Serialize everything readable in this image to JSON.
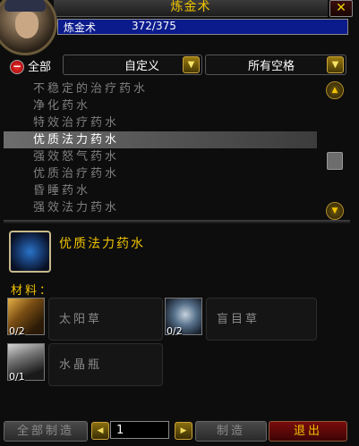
{
  "window": {
    "title": "炼金术",
    "close_icon": "close-icon"
  },
  "skill": {
    "name": "炼金术",
    "value": "372/375"
  },
  "filters": {
    "collapse_all_symbol": "−",
    "all_label": "全部",
    "subclass_dropdown": "自定义",
    "slot_dropdown": "所有空格"
  },
  "recipes": [
    {
      "name": "不稳定的治疗药水"
    },
    {
      "name": "净化药水"
    },
    {
      "name": "特效治疗药水"
    },
    {
      "name": "优质法力药水"
    },
    {
      "name": "强效怒气药水"
    },
    {
      "name": "优质治疗药水"
    },
    {
      "name": "昏睡药水"
    },
    {
      "name": "强效法力药水"
    }
  ],
  "selected_recipe_index": 3,
  "detail": {
    "name": "优质法力药水",
    "reagents_label": "材料：",
    "reagents": [
      {
        "name": "太阳草",
        "count": "0/2",
        "icon": "sungrass-icon"
      },
      {
        "name": "盲目草",
        "count": "0/2",
        "icon": "blindweed-icon"
      },
      {
        "name": "水晶瓶",
        "count": "0/1",
        "icon": "crystal-vial-icon"
      }
    ]
  },
  "footer": {
    "craft_all_label": "全部制造",
    "quantity": "1",
    "craft_label": "制造",
    "exit_label": "退出"
  }
}
